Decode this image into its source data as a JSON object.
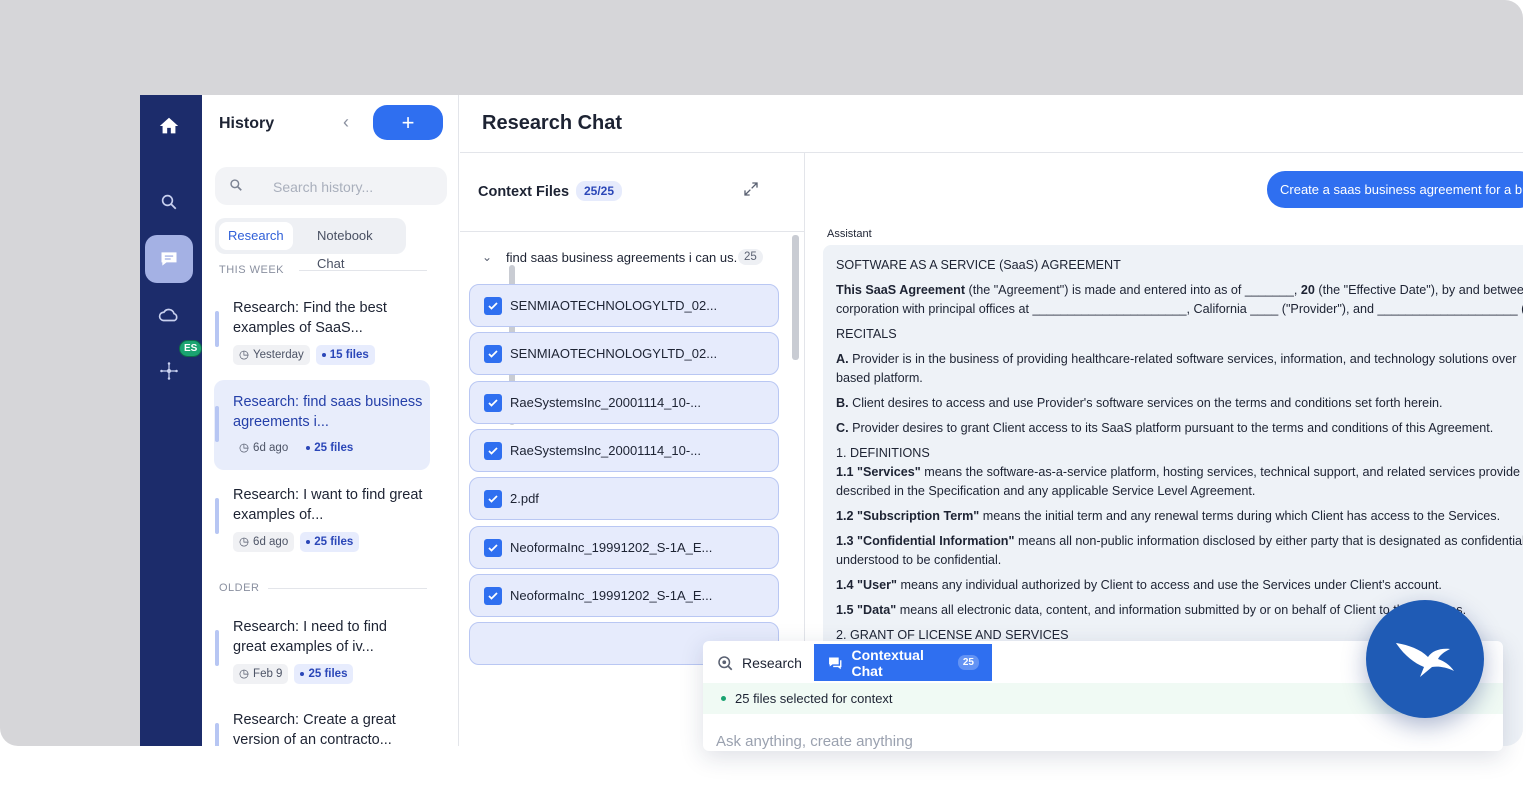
{
  "history": {
    "title": "History",
    "add_label": "+",
    "search_placeholder": "Search history...",
    "tabs": [
      "Research",
      "Notebook Chat"
    ],
    "sections": {
      "this_week": "THIS WEEK",
      "older": "OLDER"
    },
    "items": [
      {
        "title": "Research: Find the best examples of SaaS...",
        "time": "Yesterday",
        "files": "15 files"
      },
      {
        "title": "Research: find saas business agreements i...",
        "time": "6d ago",
        "files": "25 files"
      },
      {
        "title": "Research: I want to find great examples of...",
        "time": "6d ago",
        "files": "25 files"
      },
      {
        "title": "Research: I need to find great examples of iv...",
        "time": "Feb 9",
        "files": "25 files"
      },
      {
        "title": "Research: Create a great version of an contracto..."
      }
    ]
  },
  "rail": {
    "badge": "ES"
  },
  "main": {
    "title": "Research Chat"
  },
  "context": {
    "title": "Context Files",
    "count": "25/25",
    "group": {
      "name": "find saas business agreements i can us...",
      "count": "25"
    },
    "files": [
      "SENMIAOTECHNOLOGYLTD_02...",
      "SENMIAOTECHNOLOGYLTD_02...",
      "RaeSystemsInc_20001114_10-...",
      "RaeSystemsInc_20001114_10-...",
      "2.pdf",
      "NeoformaInc_19991202_S-1A_E...",
      "NeoformaInc_19991202_S-1A_E..."
    ]
  },
  "chat": {
    "user_message": "Create a saas business agreement for a bus",
    "assistant_label": "Assistant",
    "doc": {
      "heading": "SOFTWARE AS A SERVICE (SaaS) AGREEMENT",
      "intro_bold": "This SaaS Agreement",
      "intro_1": " (the \"Agreement\") is made and entered into as of _______, ",
      "intro_bold2": "20",
      "intro_2": " (the \"Effective Date\"), by and between",
      "intro_line2": "corporation with principal offices at ______________________, California ____ (\"Provider\"), and ____________________ (\"Cl",
      "recitals": "RECITALS",
      "a_lbl": "A.",
      "a_1": " Provider is in the business of providing healthcare-related software services, information, and technology solutions over",
      "a_2": "based platform.",
      "b_lbl": "B.",
      "b": " Client desires to access and use Provider's software services on the terms and conditions set forth herein.",
      "c_lbl": "C.",
      "c": " Provider desires to grant Client access to its SaaS platform pursuant to the terms and conditions of this Agreement.",
      "definitions": "1. DEFINITIONS",
      "d11_lbl": "1.1 \"Services\"",
      "d11_1": " means the software-as-a-service platform, hosting services, technical support, and related services provide",
      "d11_2": "described in the Specification and any applicable Service Level Agreement.",
      "d12_lbl": "1.2 \"Subscription Term\"",
      "d12": " means the initial term and any renewal terms during which Client has access to the Services.",
      "d13_lbl": "1.3 \"Confidential Information\"",
      "d13_1": " means all non-public information disclosed by either party that is designated as confidential",
      "d13_2": "understood to be confidential.",
      "d14_lbl": "1.4 \"User\"",
      "d14": " means any individual authorized by Client to access and use the Services under Client's account.",
      "d15_lbl": "1.5 \"Data\"",
      "d15": " means all electronic data, content, and information submitted by or on behalf of Client to the Services.",
      "grant": "2. GRANT OF LICENSE AND SERVICES"
    }
  },
  "composer": {
    "research_tab": "Research",
    "context_tab": "Contextual Chat",
    "context_badge": "25",
    "status": "25 files selected for context",
    "placeholder": "Ask anything, create anything"
  },
  "colors": {
    "rail": "#1c2c6b",
    "accent": "#2f6ff0",
    "success": "#1aa371"
  }
}
